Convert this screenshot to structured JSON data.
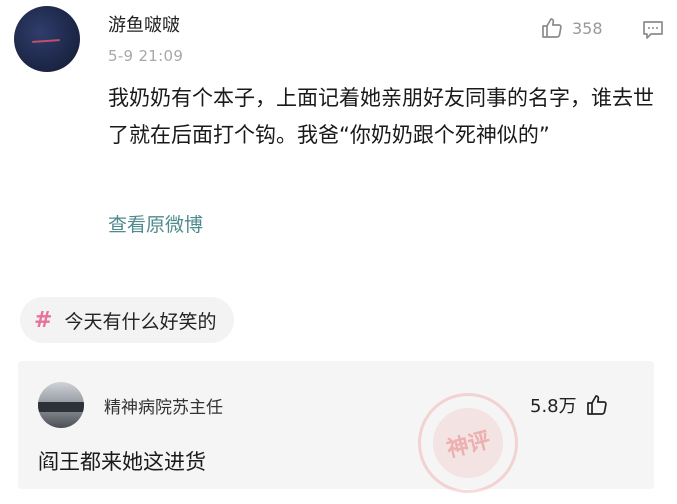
{
  "comment": {
    "username": "游鱼啵啵",
    "time": "5-9 21:09",
    "like_count": "358",
    "text": "我奶奶有个本子，上面记着她亲朋好友同事的名字，谁去世了就在后面打个钩。我爸“你奶奶跟个死神似的”",
    "view_original": "查看原微博"
  },
  "topic": {
    "hash_symbol": "#",
    "label": "今天有什么好笑的"
  },
  "reply": {
    "username": "精神病院苏主任",
    "like_count": "5.8万",
    "text": "阎王都来她这进货"
  },
  "watermark_text": "神评",
  "colors": {
    "link": "#4f8a8f",
    "hash": "#e8739a",
    "muted": "#a8a8a8",
    "card_bg": "#f5f5f5"
  },
  "icons": [
    "thumbs-up-icon",
    "comment-icon"
  ]
}
